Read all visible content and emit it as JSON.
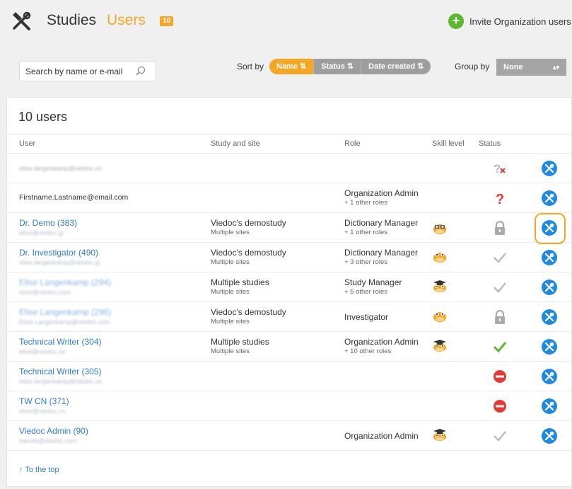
{
  "header": {
    "studies_label": "Studies",
    "users_label": "Users",
    "users_count": "10",
    "invite_label": "Invite Organization users",
    "accent": "#f5a623",
    "invite_color": "#5cb82e"
  },
  "toolbar": {
    "search_placeholder": "Search by name or e-mail",
    "sort_label": "Sort by",
    "sort_options": [
      {
        "label": "Name",
        "active": true
      },
      {
        "label": "Status",
        "active": false
      },
      {
        "label": "Date created",
        "active": false
      }
    ],
    "group_label": "Group by",
    "group_value": "None"
  },
  "panel": {
    "title": "10 users",
    "columns": [
      "User",
      "Study and site",
      "Role",
      "Skill level",
      "Status"
    ],
    "to_top": "To the top"
  },
  "rows": [
    {
      "name": "",
      "email": "elise.langenkamp@viedoc.cn",
      "study": "",
      "study_sub": "",
      "role": "",
      "role_sub": "",
      "skill": "",
      "status": "question-x"
    },
    {
      "name": "Firstname.Lastname@email.com",
      "email": "",
      "study": "",
      "study_sub": "",
      "role": "Organization Admin",
      "role_sub": "+ 1 other roles",
      "skill": "",
      "status": "question"
    },
    {
      "name": "Dr. Demo (383)",
      "email": "elise@viedoc.jp",
      "study": "Viedoc's demostudy",
      "study_sub": "Multiple sites",
      "role": "Dictionary Manager",
      "role_sub": "+ 1 other roles",
      "skill": "owl-glasses",
      "status": "lock"
    },
    {
      "name": "Dr. Investigator (490)",
      "email": "elise.langenkamp@viedoc.jp",
      "study": "Viedoc's demostudy",
      "study_sub": "Multiple sites",
      "role": "Dictionary Manager",
      "role_sub": "+ 3 other roles",
      "skill": "owl",
      "status": "check-gray"
    },
    {
      "name": "Elise Langenkamp (294)",
      "email": "elise@viedoc.com",
      "study": "Multiple studies",
      "study_sub": "Multiple sites",
      "role": "Study Manager",
      "role_sub": "+ 5 other roles",
      "skill": "owl-grad",
      "status": "check-gray"
    },
    {
      "name": "Elise Langenkamp (296)",
      "email": "Elise.Langenkamp@viedoc.com",
      "study": "Viedoc's demostudy",
      "study_sub": "Multiple sites",
      "role": "Investigator",
      "role_sub": "",
      "skill": "owl",
      "status": "lock"
    },
    {
      "name": "Technical Writer (304)",
      "email": "elise@viedoc.se",
      "study": "Multiple studies",
      "study_sub": "Multiple sites",
      "role": "Organization Admin",
      "role_sub": "+ 10 other roles",
      "skill": "owl-grad",
      "status": "check-green"
    },
    {
      "name": "Technical Writer (305)",
      "email": "elise.langenkamp@viedoc.se",
      "study": "",
      "study_sub": "",
      "role": "",
      "role_sub": "",
      "skill": "",
      "status": "blocked"
    },
    {
      "name": "TW CN (371)",
      "email": "elise@viedoc.cn",
      "study": "",
      "study_sub": "",
      "role": "",
      "role_sub": "",
      "skill": "",
      "status": "blocked"
    },
    {
      "name": "Viedoc Admin (90)",
      "email": "hanofs@viedoc.com",
      "study": "",
      "study_sub": "",
      "role": "Organization Admin",
      "role_sub": "",
      "skill": "owl-grad",
      "status": "check-gray"
    }
  ]
}
